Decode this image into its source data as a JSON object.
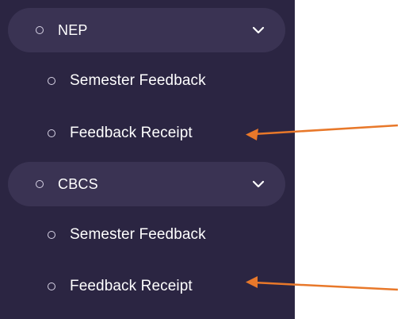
{
  "sidebar": {
    "groups": [
      {
        "label": "NEP",
        "items": [
          {
            "label": "Semester Feedback"
          },
          {
            "label": "Feedback Receipt"
          }
        ]
      },
      {
        "label": "CBCS",
        "items": [
          {
            "label": "Semester Feedback"
          },
          {
            "label": "Feedback Receipt"
          }
        ]
      }
    ]
  },
  "annotations": {
    "arrow_color": "#e8782a"
  },
  "colors": {
    "sidebar_bg": "#2b2542",
    "group_bg": "#3a3353",
    "text": "#ffffff"
  }
}
